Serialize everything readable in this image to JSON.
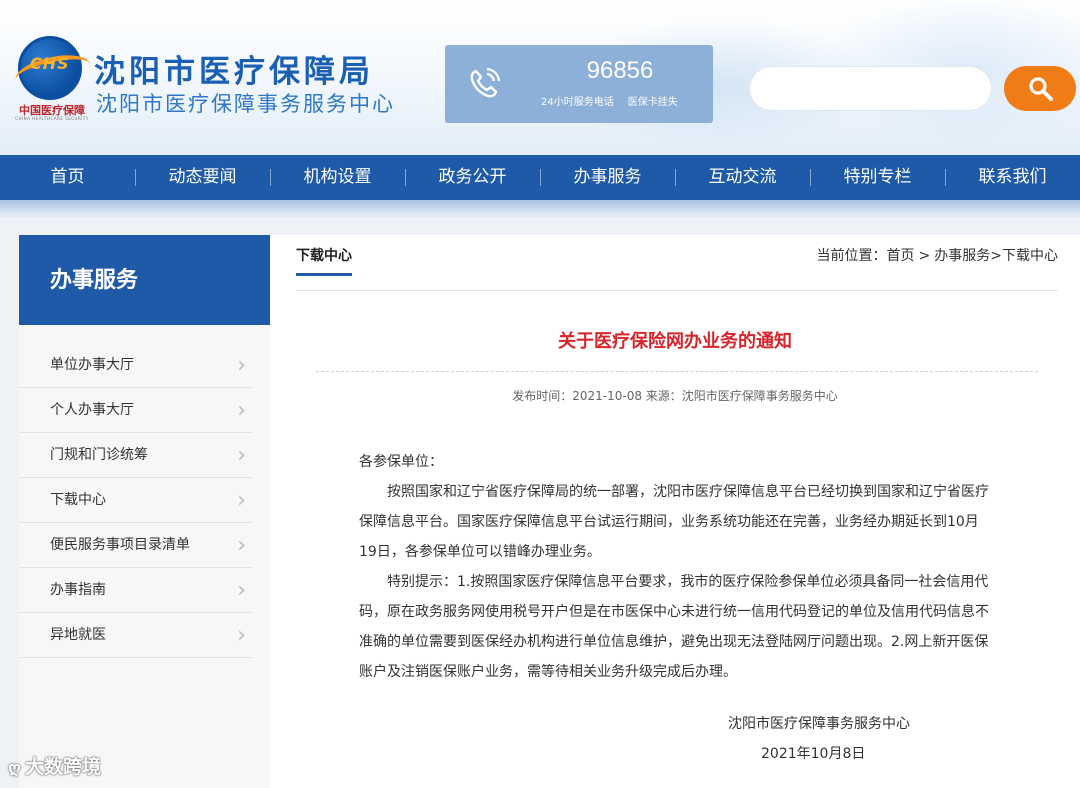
{
  "header": {
    "logo_text": "CHS",
    "logo_cn": "中国医疗保障",
    "logo_en": "CHINA HEALTHCARE SECURITY",
    "site_title": "沈阳市医疗保障局",
    "site_subtitle": "沈阳市医疗保障事务服务中心",
    "hotline": {
      "number": "96856",
      "desc_left": "24小时服务电话",
      "desc_right": "医保卡挂失"
    },
    "search": {
      "placeholder": "",
      "value": ""
    }
  },
  "nav": {
    "items": [
      "首页",
      "动态要闻",
      "机构设置",
      "政务公开",
      "办事服务",
      "互动交流",
      "特别专栏",
      "联系我们"
    ]
  },
  "sidebar": {
    "title": "办事服务",
    "items": [
      {
        "label": "单位办事大厅"
      },
      {
        "label": "个人办事大厅"
      },
      {
        "label": "门规和门诊统筹"
      },
      {
        "label": "下载中心"
      },
      {
        "label": "便民服务事项目录清单"
      },
      {
        "label": "办事指南"
      },
      {
        "label": "异地就医"
      }
    ],
    "chevron": "›"
  },
  "main": {
    "tab": "下载中心",
    "breadcrumb": {
      "prefix": "当前位置：",
      "items": [
        "首页",
        "办事服务",
        "下载中心"
      ],
      "sep1": ">",
      "sep2": ">"
    },
    "article": {
      "title": "关于医疗保险网办业务的通知",
      "meta": "发布时间：2021-10-08 来源：沈阳市医疗保障事务服务中心",
      "greeting": "各参保单位：",
      "para1": "按照国家和辽宁省医疗保障局的统一部署，沈阳市医疗保障信息平台已经切换到国家和辽宁省医疗保障信息平台。国家医疗保障信息平台试运行期间，业务系统功能还在完善，业务经办期延长到10月19日，各参保单位可以错峰办理业务。",
      "para2": "特别提示：1.按照国家医疗保障信息平台要求，我市的医疗保险参保单位必须具备同一社会信用代码，原在政务服务网使用税号开户但是在市医保中心未进行统一信用代码登记的单位及信用代码信息不准确的单位需要到医保经办机构进行单位信息维护，避免出现无法登陆网厅问题出现。2.网上新开医保账户及注销医保账户业务，需等待相关业务升级完成后办理。",
      "sign_org": "沈阳市医疗保障事务服务中心",
      "sign_date": "2021年10月8日"
    }
  },
  "watermark": {
    "icon": "ღ",
    "text": "大数跨境"
  },
  "colors": {
    "brand_blue": "#1e5aa8",
    "accent_orange": "#f07c18",
    "title_red": "#d7252c"
  },
  "icons": {
    "phone": "phone-icon",
    "search": "search-icon",
    "chevron": "chevron-right-icon"
  }
}
